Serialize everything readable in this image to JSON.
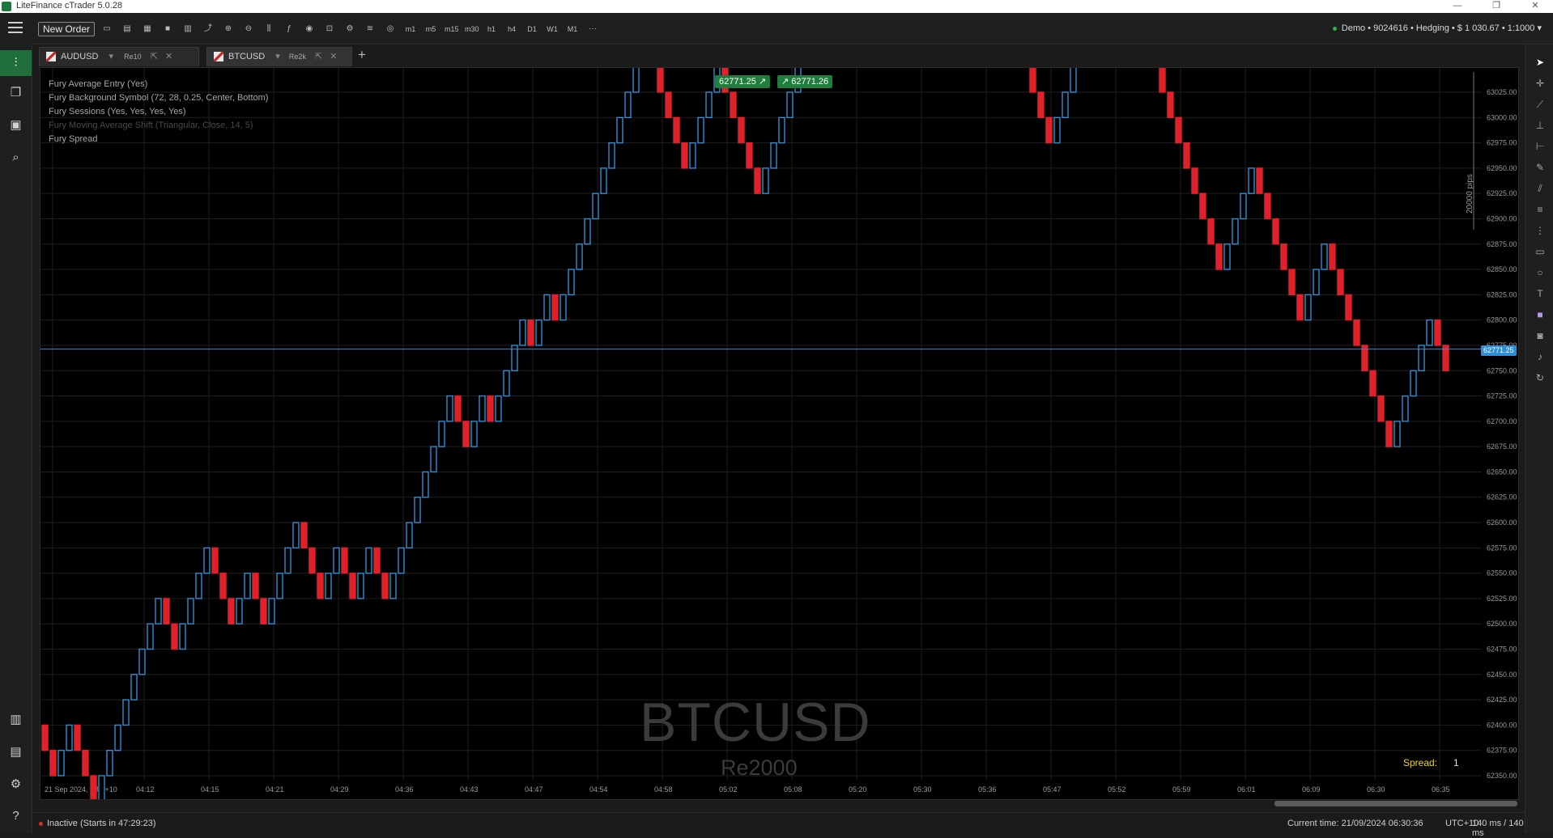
{
  "window": {
    "title": "LiteFinance cTrader 5.0.28"
  },
  "toolbar": {
    "new_order_label": "New Order",
    "timeframes": [
      "m1",
      "m5",
      "m15",
      "m30",
      "h1",
      "h4",
      "D1",
      "W1",
      "M1"
    ],
    "account": "Demo • 9024616 • Hedging • $ 1 030.67 • 1:1000"
  },
  "tabs": [
    {
      "symbol": "AUDUSD",
      "type": "Re10",
      "active": false
    },
    {
      "symbol": "BTCUSD",
      "type": "Re2k",
      "active": true
    }
  ],
  "chart": {
    "legend": [
      "Fury Average Entry (Yes)",
      "Fury Background Symbol (72, 28, 0.25, Center, Bottom)",
      "Fury Sessions (Yes, Yes, Yes, Yes)",
      "Fury Moving Average Shift (Triangular, Close, 14, 5)",
      "Fury Spread"
    ],
    "bid_chip": "62771.25",
    "ask_chip": "62771.26",
    "current_price_label": "62771.25",
    "watermark_symbol": "BTCUSD",
    "watermark_type": "Re2000",
    "spread_label": "Spread:",
    "spread_value": "1",
    "pips_label": "20000 pips",
    "colors": {
      "up": "#2e8ed6",
      "down": "#e0202a",
      "grid": "#1f1f1f",
      "price_line": "#2e8ed6"
    }
  },
  "chart_data": {
    "type": "renko",
    "brick_size": 2000,
    "ylim": [
      62350,
      63025
    ],
    "y_ticks": [
      62350,
      62375,
      62400,
      62425,
      62450,
      62475,
      62500,
      62525,
      62550,
      62575,
      62600,
      62625,
      62650,
      62675,
      62700,
      62725,
      62750,
      62775,
      62800,
      62825,
      62850,
      62875,
      62900,
      62925,
      62950,
      62975,
      63000,
      63025
    ],
    "x_ticks": [
      "21 Sep 2024, UTC+10",
      "04:12",
      "04:15",
      "04:21",
      "04:29",
      "04:36",
      "04:43",
      "04:47",
      "04:54",
      "04:58",
      "05:02",
      "05:08",
      "05:20",
      "05:30",
      "05:36",
      "05:47",
      "05:52",
      "05:59",
      "06:01",
      "06:09",
      "06:30",
      "06:35"
    ],
    "bricks": [
      -1,
      -1,
      1,
      1,
      -1,
      -1,
      -1,
      1,
      1,
      1,
      1,
      1,
      1,
      1,
      1,
      -1,
      -1,
      1,
      1,
      1,
      1,
      -1,
      -1,
      -1,
      1,
      1,
      -1,
      -1,
      1,
      1,
      1,
      1,
      -1,
      -1,
      -1,
      1,
      1,
      -1,
      -1,
      1,
      1,
      -1,
      -1,
      1,
      1,
      1,
      1,
      1,
      1,
      1,
      1,
      -1,
      -1,
      1,
      1,
      -1,
      1,
      1,
      1,
      1,
      -1,
      1,
      1,
      -1,
      1,
      1,
      1,
      1,
      1,
      1,
      1,
      1,
      1,
      1,
      1,
      -1,
      -1,
      -1,
      -1,
      -1,
      1,
      1,
      1,
      1,
      -1,
      -1,
      -1,
      -1,
      -1,
      1,
      1,
      1,
      1,
      1,
      1,
      1,
      1,
      1,
      1,
      -1,
      -1,
      -1,
      -1,
      1,
      -1,
      1,
      1,
      -1,
      -1,
      1,
      1,
      1,
      1,
      1,
      1,
      -1,
      -1,
      -1,
      -1,
      -1,
      -1,
      -1,
      -1,
      -1,
      -1,
      1,
      1,
      1,
      1,
      -1,
      1,
      1,
      1,
      1,
      -1,
      -1,
      -1,
      -1,
      -1,
      -1,
      -1,
      -1,
      -1,
      -1,
      -1,
      -1,
      1,
      1,
      1,
      1,
      -1,
      -1,
      -1,
      -1,
      -1,
      -1,
      1,
      1,
      1,
      -1,
      -1,
      -1,
      -1,
      -1,
      -1,
      -1,
      -1,
      1,
      1,
      1,
      1,
      1,
      -1,
      -1
    ],
    "current_price": 62771.25
  },
  "status": {
    "session": "Inactive (Starts in 47:29:23)",
    "current_time": "Current time:  21/09/2024 06:30:36",
    "tz": "UTC+10",
    "latency": "140 ms / 140 ms"
  }
}
